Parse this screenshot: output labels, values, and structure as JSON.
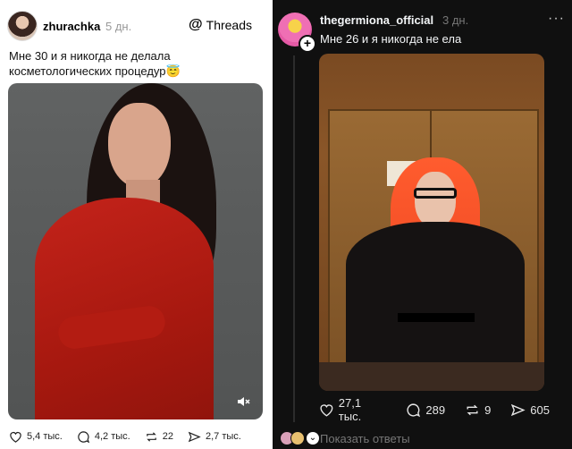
{
  "left_post": {
    "username": "zhurachka",
    "time": "5 дн.",
    "app_label": "Threads",
    "caption": "Мне 30 и я никогда не делала косметологических процедур😇",
    "actions": {
      "likes": "5,4 тыс.",
      "comments": "4,2 тыс.",
      "reposts": "22",
      "shares": "2,7 тыс."
    }
  },
  "right_post": {
    "username": "thegermiona_official",
    "time": "3 дн.",
    "more": "···",
    "caption": "Мне 26 и я никогда не ела",
    "actions": {
      "likes": "27,1 тыс.",
      "comments": "289",
      "reposts": "9",
      "shares": "605"
    },
    "replies_label": "Показать ответы"
  },
  "colors": {
    "left_background": "#ffffff",
    "right_background": "#101010",
    "dress_red": "#c4231a",
    "hair_orange": "#ff5c2e"
  },
  "icons": [
    "heart-icon",
    "comment-icon",
    "repost-icon",
    "share-icon",
    "mute-icon",
    "threads-logo-icon",
    "plus-icon"
  ]
}
